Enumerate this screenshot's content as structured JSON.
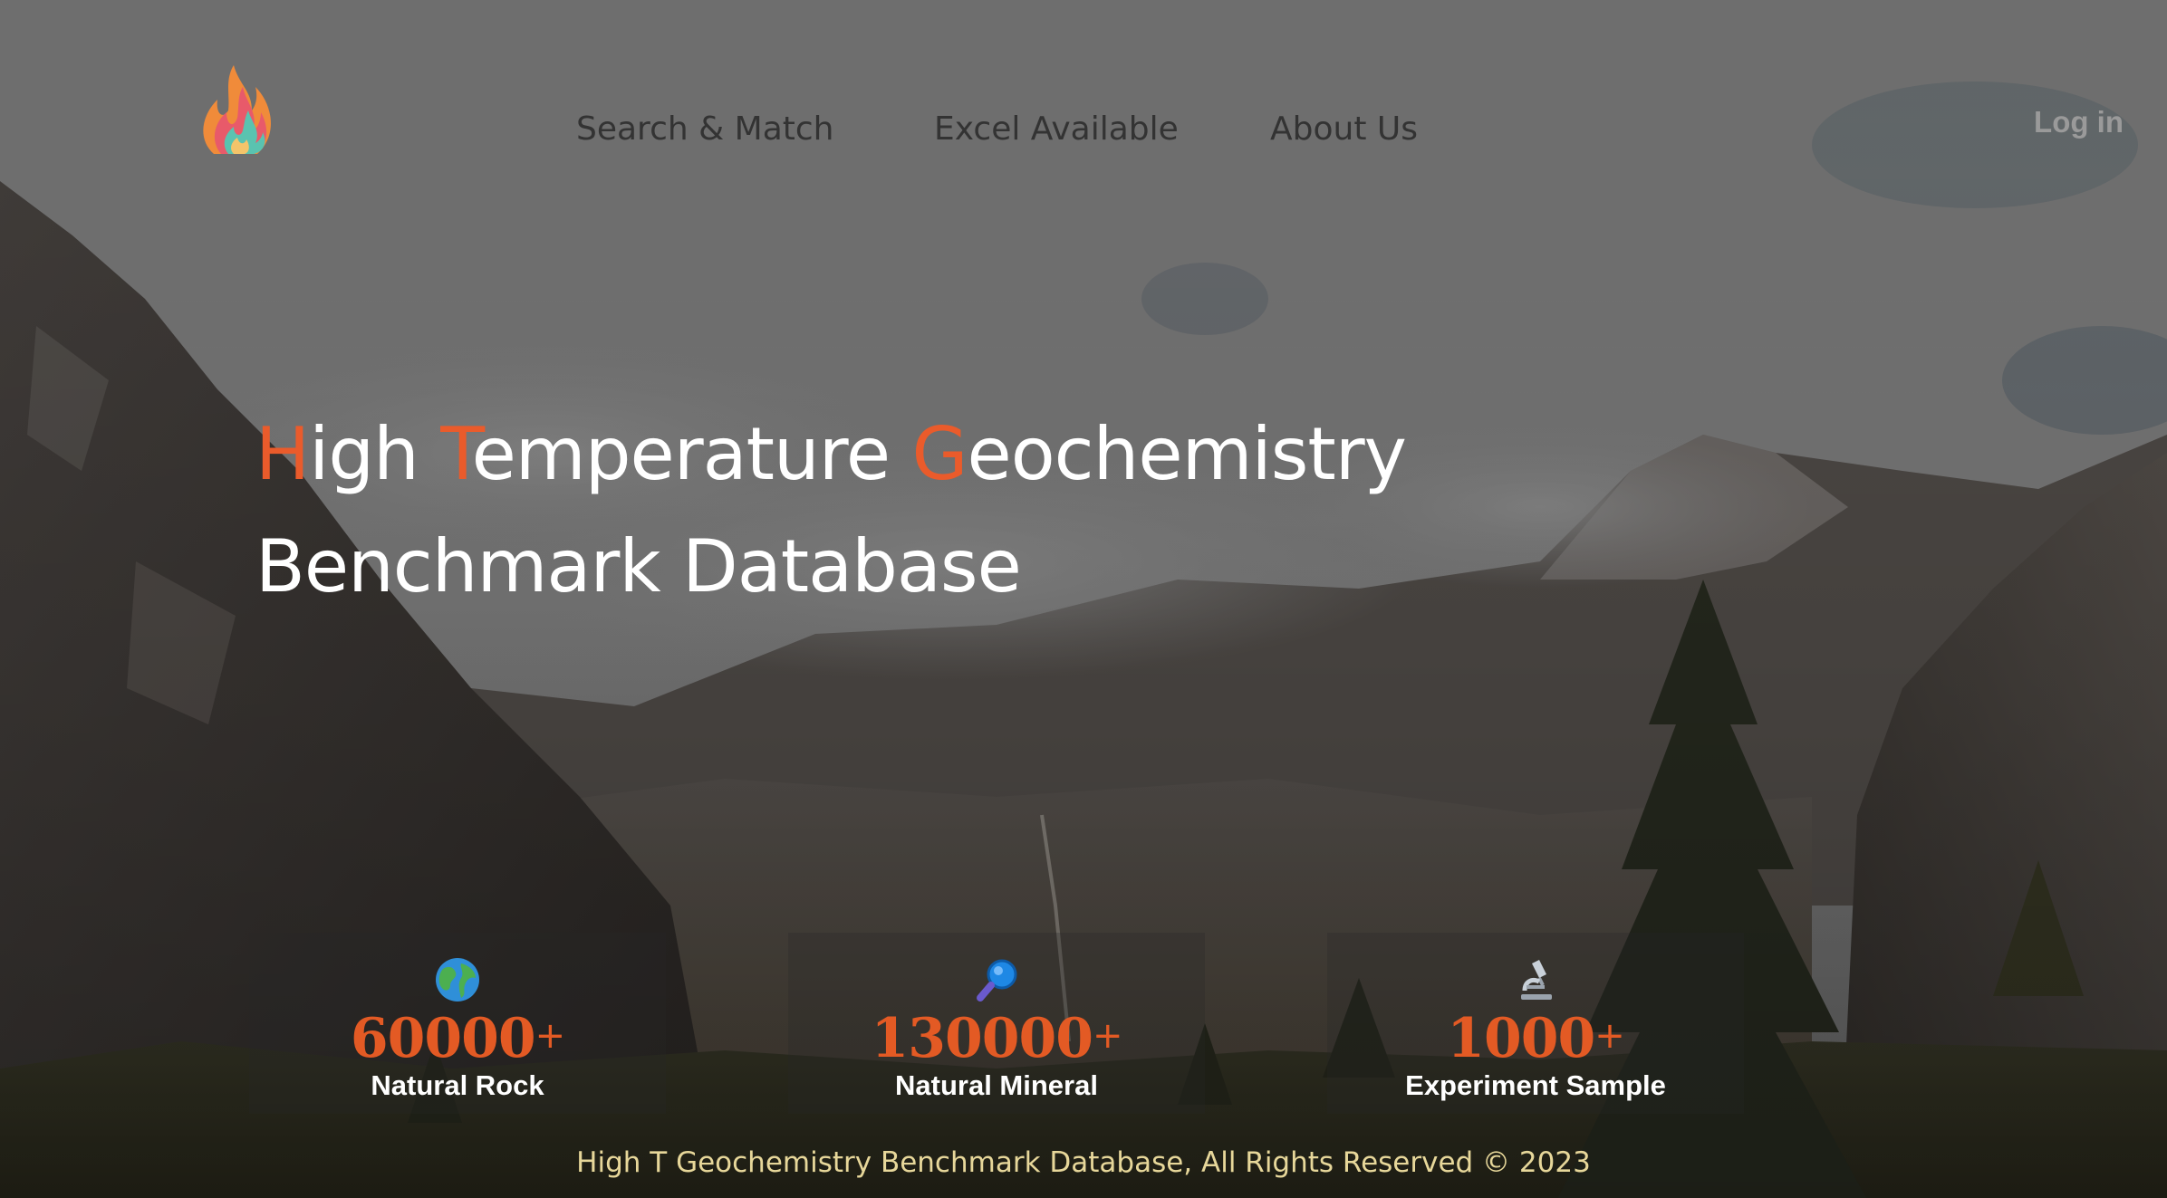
{
  "header": {
    "nav": [
      {
        "label": "Search & Match"
      },
      {
        "label": "Excel Available"
      },
      {
        "label": "About Us"
      }
    ],
    "login_label": "Log in",
    "logo_icon": "flame-logo-icon"
  },
  "hero": {
    "line1": [
      {
        "accent": "H",
        "rest": "igh "
      },
      {
        "accent": "T",
        "rest": "emperature "
      },
      {
        "accent": "G",
        "rest": "eochemistry"
      }
    ],
    "line2": "Benchmark Database",
    "accent_color": "#ea5b2b"
  },
  "stats": [
    {
      "icon": "globe-icon",
      "number": "60000",
      "suffix": "+",
      "label": "Natural Rock"
    },
    {
      "icon": "magnifier-icon",
      "number": "130000",
      "suffix": "+",
      "label": "Natural Mineral"
    },
    {
      "icon": "microscope-icon",
      "number": "1000",
      "suffix": "+",
      "label": "Experiment Sample"
    }
  ],
  "footer": {
    "text": "High T Geochemistry Benchmark Database, All Rights Reserved © 2023"
  },
  "colors": {
    "accent": "#ea5b2b",
    "stat_number": "#e35a24",
    "footer_text": "#e7d79a"
  }
}
